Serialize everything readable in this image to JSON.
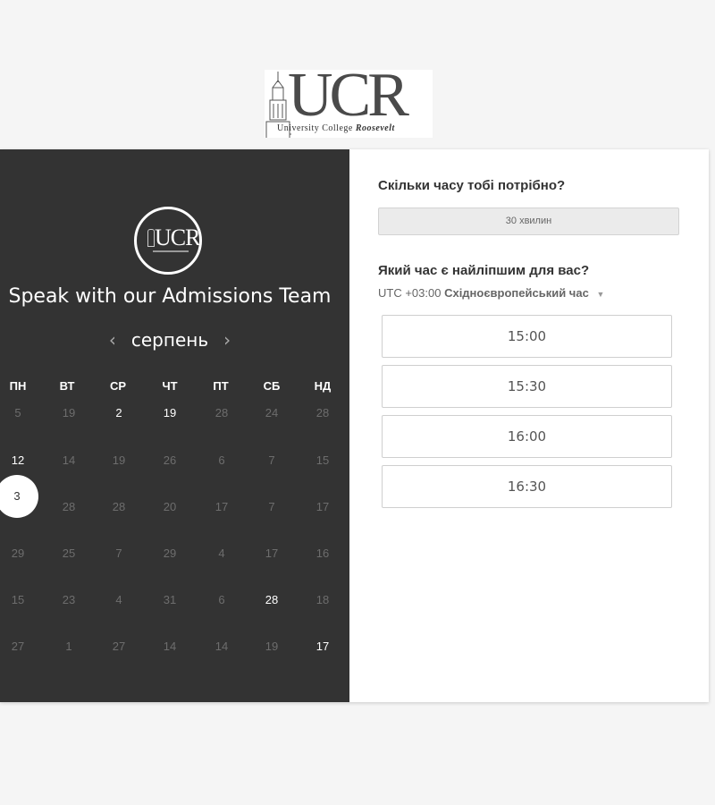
{
  "brand": {
    "logo_letters": "UCR",
    "logo_sub_regular": "University College ",
    "logo_sub_italic": "Roosevelt"
  },
  "left": {
    "heading": "Speak with our Admissions Team",
    "month": "серпень",
    "prev_icon": "chevron-left-icon",
    "next_icon": "chevron-right-icon",
    "weekdays": [
      "ПН",
      "ВТ",
      "СР",
      "ЧТ",
      "ПТ",
      "СБ",
      "НД"
    ],
    "weeks": [
      [
        "5",
        "19",
        "2",
        "19",
        "28",
        "24",
        "28"
      ],
      [
        "12",
        "14",
        "19",
        "26",
        "6",
        "7",
        "15"
      ],
      [
        "3",
        "28",
        "28",
        "20",
        "17",
        "7",
        "17"
      ],
      [
        "29",
        "25",
        "7",
        "29",
        "4",
        "17",
        "16"
      ],
      [
        "15",
        "23",
        "4",
        "31",
        "6",
        "28",
        "18"
      ],
      [
        "27",
        "1",
        "27",
        "14",
        "14",
        "19",
        "17"
      ]
    ]
  },
  "right": {
    "duration_question": "Скільки часу тобі потрібно?",
    "duration_value": "30 хвилин",
    "time_question": "Який час є найліпшим для вас?",
    "timezone_offset": "UTC +03:00",
    "timezone_name": "Східноєвропейський час",
    "timezone_caret": "▼",
    "slots": [
      "15:00",
      "15:30",
      "16:00",
      "16:30"
    ]
  }
}
